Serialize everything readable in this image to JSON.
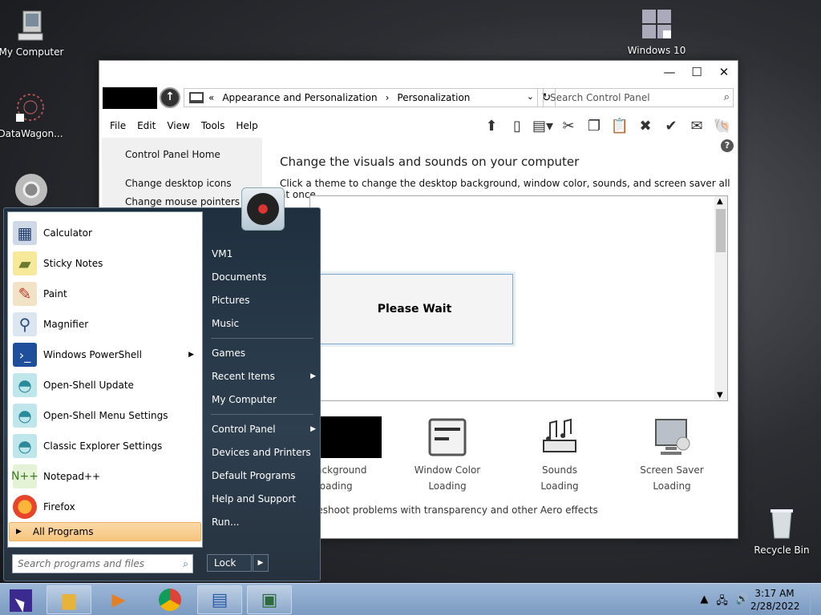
{
  "desktop": {
    "icons": [
      {
        "label": "My Computer"
      },
      {
        "label": "DataWagon..."
      },
      {
        "label": "Windows 10"
      },
      {
        "label": "Recycle Bin"
      }
    ]
  },
  "window": {
    "controls": {
      "minimize": "—",
      "maximize": "☐",
      "close": "✕"
    },
    "breadcrumb": {
      "prefix": "«",
      "items": [
        "Appearance and Personalization",
        "Personalization"
      ]
    },
    "search_placeholder": "Search Control Panel",
    "menus": [
      "File",
      "Edit",
      "View",
      "Tools",
      "Help"
    ],
    "left_pane": {
      "links": [
        "Control Panel Home",
        "Change desktop icons",
        "Change mouse pointers"
      ]
    },
    "main": {
      "title": "Change the visuals and sounds on your computer",
      "subtitle": "Click a theme to change the desktop background, window color, sounds, and screen saver all at once.",
      "please_wait": "Please Wait",
      "options": [
        {
          "label": "p Background",
          "sub": "Loading"
        },
        {
          "label": "Window Color",
          "sub": "Loading"
        },
        {
          "label": "Sounds",
          "sub": "Loading"
        },
        {
          "label": "Screen Saver",
          "sub": "Loading"
        }
      ],
      "troubleshoot": "leshoot problems with transparency and other Aero effects"
    }
  },
  "start_menu": {
    "apps": [
      {
        "label": "Calculator",
        "icon": "calculator-icon"
      },
      {
        "label": "Sticky Notes",
        "icon": "sticky-notes-icon"
      },
      {
        "label": "Paint",
        "icon": "paint-icon"
      },
      {
        "label": "Magnifier",
        "icon": "magnifier-icon"
      },
      {
        "label": "Windows PowerShell",
        "icon": "powershell-icon"
      },
      {
        "label": "Open-Shell Update",
        "icon": "shell-icon"
      },
      {
        "label": "Open-Shell Menu Settings",
        "icon": "shell-icon"
      },
      {
        "label": "Classic Explorer Settings",
        "icon": "shell-icon"
      },
      {
        "label": "Notepad++",
        "icon": "notepad-plus-icon"
      },
      {
        "label": "Firefox",
        "icon": "firefox-icon"
      }
    ],
    "all_programs": "All Programs",
    "search_placeholder": "Search programs and files",
    "right_links": [
      {
        "label": "VM1"
      },
      {
        "label": "Documents"
      },
      {
        "label": "Pictures"
      },
      {
        "label": "Music"
      },
      {
        "label": "Games"
      },
      {
        "label": "Recent Items"
      },
      {
        "label": "My Computer"
      },
      {
        "label": "Control Panel"
      },
      {
        "label": "Devices and Printers"
      },
      {
        "label": "Default Programs"
      },
      {
        "label": "Help and Support"
      },
      {
        "label": "Run..."
      }
    ],
    "lock": "Lock"
  },
  "taskbar": {
    "time": "3:17 AM",
    "date": "2/28/2022"
  }
}
